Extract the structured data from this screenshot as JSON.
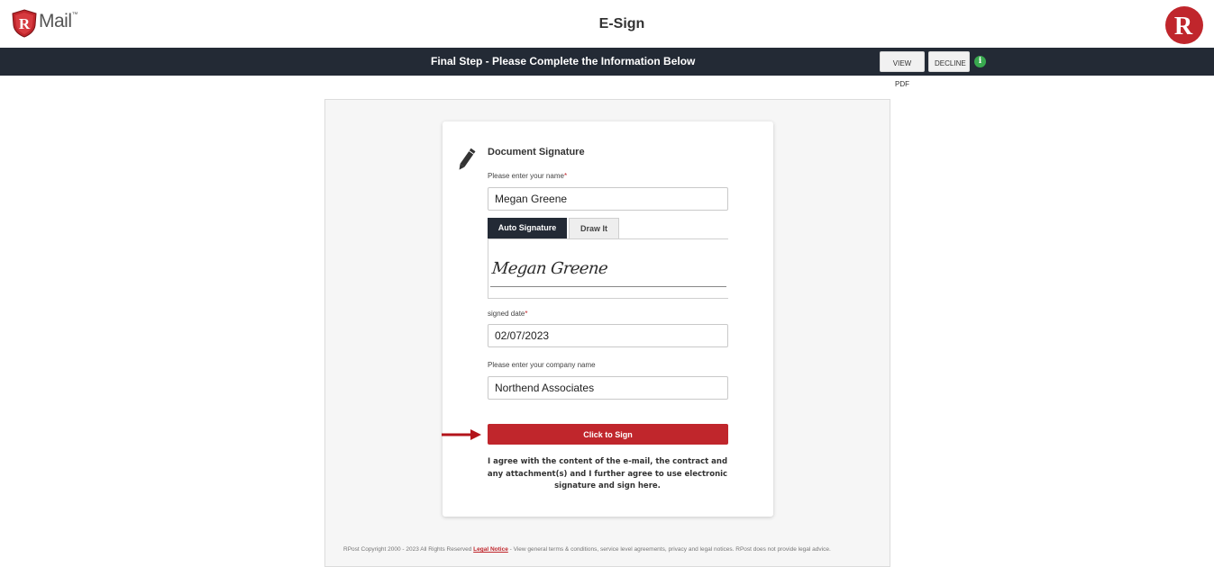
{
  "header": {
    "logo_text": "Mail",
    "logo_letter": "R",
    "logo_tm": "™",
    "title": "E-Sign",
    "brand_letter": "R"
  },
  "stepbar": {
    "text": "Final Step - Please Complete the Information Below",
    "view_pdf_label": "VIEW PDF",
    "decline_label": "DECLINE",
    "info_glyph": "i"
  },
  "form": {
    "title": "Document Signature",
    "name_label": "Please enter your name",
    "required_mark": "*",
    "name_value": "Megan Greene",
    "tabs": [
      {
        "label": "Auto Signature",
        "active": true
      },
      {
        "label": "Draw It",
        "active": false
      }
    ],
    "signature_text": "Megan Greene",
    "date_label": "signed date",
    "date_value": "02/07/2023",
    "company_label": "Please enter your company name",
    "company_value": "Northend Associates",
    "sign_button": "Click to Sign",
    "agreement": "I agree with the content of the e-mail, the contract and any attachment(s) and I further agree to use electronic signature and sign here."
  },
  "footer": {
    "copyright": "RPost Copyright 2000 - 2023 All Rights Reserved",
    "legal_link": "Legal Notice",
    "legal_text": "- View general terms & conditions, service level agreements, privacy and legal notices. RPost does not provide legal advice."
  },
  "colors": {
    "accent_red": "#c0262c",
    "dark_bar": "#232a35",
    "info_green": "#39a94f"
  }
}
